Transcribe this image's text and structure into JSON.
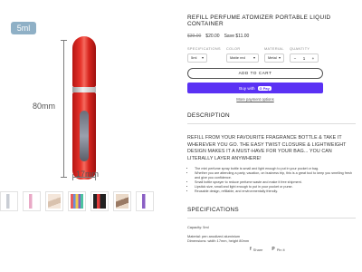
{
  "image": {
    "size_badge": "5ml",
    "height_label": "80mm",
    "width_label": "17mm",
    "thumbnails": [
      {
        "icon": "bottle-silver-thumb",
        "color": "#c9cdd4"
      },
      {
        "icon": "bottle-pink-thumb",
        "color": "#e9a9c6"
      },
      {
        "icon": "bottle-hand-thumb",
        "color": "#d9c2ae"
      },
      {
        "icon": "bottle-multi-thumb",
        "color": "#6b8fd8"
      },
      {
        "icon": "bottle-dark-thumb",
        "color": "#3a3a3a"
      },
      {
        "icon": "bottle-hand-dark-thumb",
        "color": "#9a7a64"
      },
      {
        "icon": "bottle-purple-thumb",
        "color": "#8a5fc4"
      }
    ]
  },
  "product": {
    "title": "REFILL PERFUME ATOMIZER PORTABLE LIQUID CONTAINER",
    "old_price": "$39.00",
    "price": "$20.00",
    "save": "Save $11.00"
  },
  "options": {
    "specifications": {
      "label": "SPECIFICATIONS",
      "value": "5ml"
    },
    "color": {
      "label": "COLOR",
      "value": "Matte red"
    },
    "material": {
      "label": "MATERIAL",
      "value": "Metal"
    },
    "quantity": {
      "label": "QUANTITY",
      "value": "1",
      "minus": "−",
      "plus": "+"
    }
  },
  "buttons": {
    "add_to_cart": "ADD TO CART",
    "buy_now": "Buy with",
    "buy_now_brand": "G Pay",
    "more_payment": "More payment options"
  },
  "description": {
    "heading": "DESCRIPTION",
    "intro": "REFILL FROM YOUR FAVOURITE FRAGRANCE BOTTLE & TAKE IT WHEREVER YOU GO. THE EASY TWIST CLOSURE & LIGHTWEIGHT DESIGN MAKES IT A MUST-HAVE FOR YOUR BAG... YOU CAN LITERALLY LAYER ANYWHERE!",
    "bullets": [
      "The mini perfume spray bottle is small and light enough to put in your pocket or bag.",
      "Whether you are attending a party, vacation, on business trip, this is a great tool to keep you smelling fresh and give you confidence.",
      "Small bottle sprayer to reduce perfume waste and make it free shipment.",
      "Lipstick size, small and light enough to put in your pocket or purse.",
      "Reusable design, refillable, and environmentally friendly."
    ]
  },
  "specifications": {
    "heading": "SPECIFICATIONS",
    "capacity": "Capacity: 5ml",
    "material": "Material: pen anodized aluminium",
    "dimensions": "Dimensions: width 17mm, height 80mm"
  },
  "share": {
    "share_label": "Share",
    "pin_label": "Pin it"
  }
}
